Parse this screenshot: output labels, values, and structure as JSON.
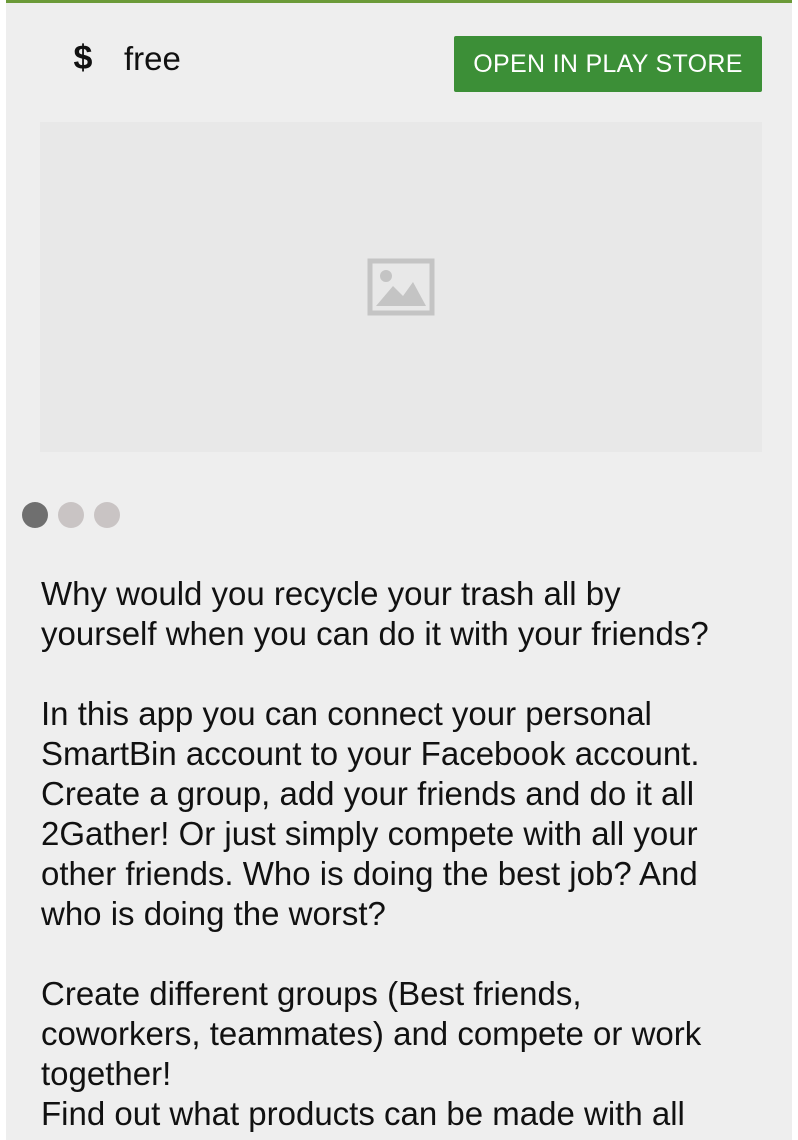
{
  "header": {
    "price_icon": "dollar-icon",
    "price": "free",
    "open_button_label": "OPEN IN PLAY STORE",
    "accent_color": "#3c8f37"
  },
  "gallery": {
    "image_placeholder_icon": "image-icon",
    "pager_count": 3,
    "active_index": 0
  },
  "description": {
    "p1_line1": "Why would you recycle your trash all by",
    "p1_line2": "yourself when you can do it with your friends?",
    "p2_line1": "In this app you can connect your personal",
    "p2_line2": "SmartBin account to your Facebook account.",
    "p2_line3": "Create a group, add your friends and do it all",
    "p2_line4": "2Gather! Or just simply compete with all your",
    "p2_line5": "other friends. Who is doing the best job? And",
    "p2_line6": "who is doing the worst?",
    "p3_line1": "Create different groups (Best friends,",
    "p3_line2": "coworkers, teammates) and compete or work",
    "p3_line3": "together!",
    "p4_line1": "Find out what products can be made with all"
  }
}
